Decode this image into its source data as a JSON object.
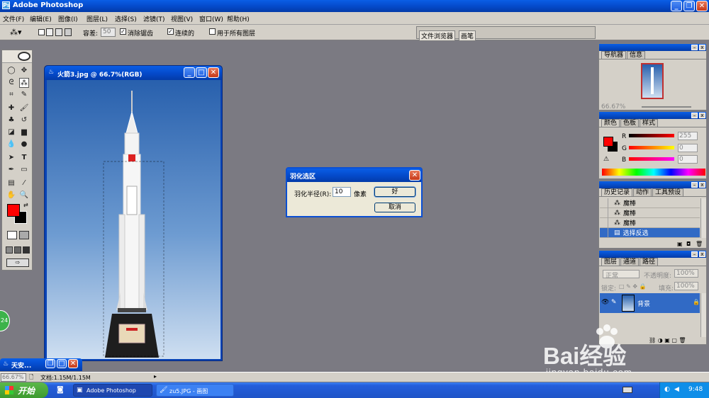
{
  "app": {
    "title": "Adobe Photoshop"
  },
  "menu": [
    "文件(F)",
    "编辑(E)",
    "图像(I)",
    "图层(L)",
    "选择(S)",
    "滤镜(T)",
    "视图(V)",
    "窗口(W)",
    "帮助(H)"
  ],
  "options": {
    "tolerance_label": "容差:",
    "tolerance_value": "50",
    "antialias_label": "消除锯齿",
    "contiguous_label": "连续的",
    "all_layers_label": "用于所有图层"
  },
  "palette_well": {
    "file_browser": "文件浏览器",
    "brushes": "画笔"
  },
  "document": {
    "title": "火箭3.jpg @ 66.7%(RGB)"
  },
  "dialog": {
    "title": "羽化选区",
    "radius_label": "羽化半径(R):",
    "radius_value": "10",
    "unit": "像素",
    "ok": "好",
    "cancel": "取消"
  },
  "navigator": {
    "tabs": [
      "导航器",
      "信息"
    ],
    "zoom": "66.67%"
  },
  "color": {
    "tabs": [
      "颜色",
      "色板",
      "样式"
    ],
    "r_label": "R",
    "g_label": "G",
    "b_label": "B",
    "r_value": "255",
    "g_value": "0",
    "b_value": "0"
  },
  "history": {
    "tabs": [
      "历史记录",
      "动作",
      "工具预设"
    ],
    "items": [
      "魔棒",
      "魔棒",
      "魔棒",
      "选择反选"
    ]
  },
  "layers": {
    "tabs": [
      "图层",
      "通道",
      "路径"
    ],
    "blend_mode": "正常",
    "opacity_label": "不透明度:",
    "opacity_value": "100%",
    "lock_label": "锁定:",
    "fill_label": "填充:",
    "fill_value": "100%",
    "layer_name": "背景"
  },
  "minimized": {
    "title": "天安..."
  },
  "status": {
    "zoom": "66.67%",
    "doc": "文档:1.15M/1.15M"
  },
  "taskbar": {
    "start": "开始",
    "tasks": [
      "Adobe Photoshop",
      "zu5.JPG - 画图"
    ],
    "time": "9:48"
  },
  "watermark": {
    "brand": "Bai经验",
    "url": "jingyan.baidu.com"
  },
  "green_badge": "24",
  "colors": {
    "accent": "#0a5ee6",
    "foreground": "#ff0000",
    "taskbar": "#245edb",
    "start": "#3c9a2e"
  }
}
